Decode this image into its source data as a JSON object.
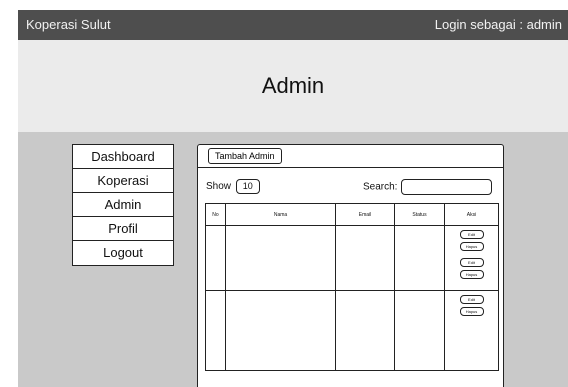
{
  "topbar": {
    "brand": "Koperasi Sulut",
    "login_text": "Login sebagai : admin"
  },
  "header": {
    "title": "Admin"
  },
  "menu": [
    {
      "label": "Dashboard"
    },
    {
      "label": "Koperasi"
    },
    {
      "label": "Admin"
    },
    {
      "label": "Profil"
    },
    {
      "label": "Logout"
    }
  ],
  "panel": {
    "add_button": "Tambah Admin",
    "show_label": "Show",
    "show_value": "10",
    "search_label": "Search:",
    "search_value": ""
  },
  "table": {
    "headers": [
      "No",
      "Nama",
      "Email",
      "Status",
      "Aksi"
    ],
    "rows": [
      {
        "actions": [
          {
            "edit": "Edit",
            "delete": "Hapus"
          },
          {
            "edit": "Edit",
            "delete": "Hapus"
          }
        ]
      },
      {
        "actions": [
          {
            "edit": "Edit",
            "delete": "Hapus"
          }
        ]
      }
    ]
  }
}
